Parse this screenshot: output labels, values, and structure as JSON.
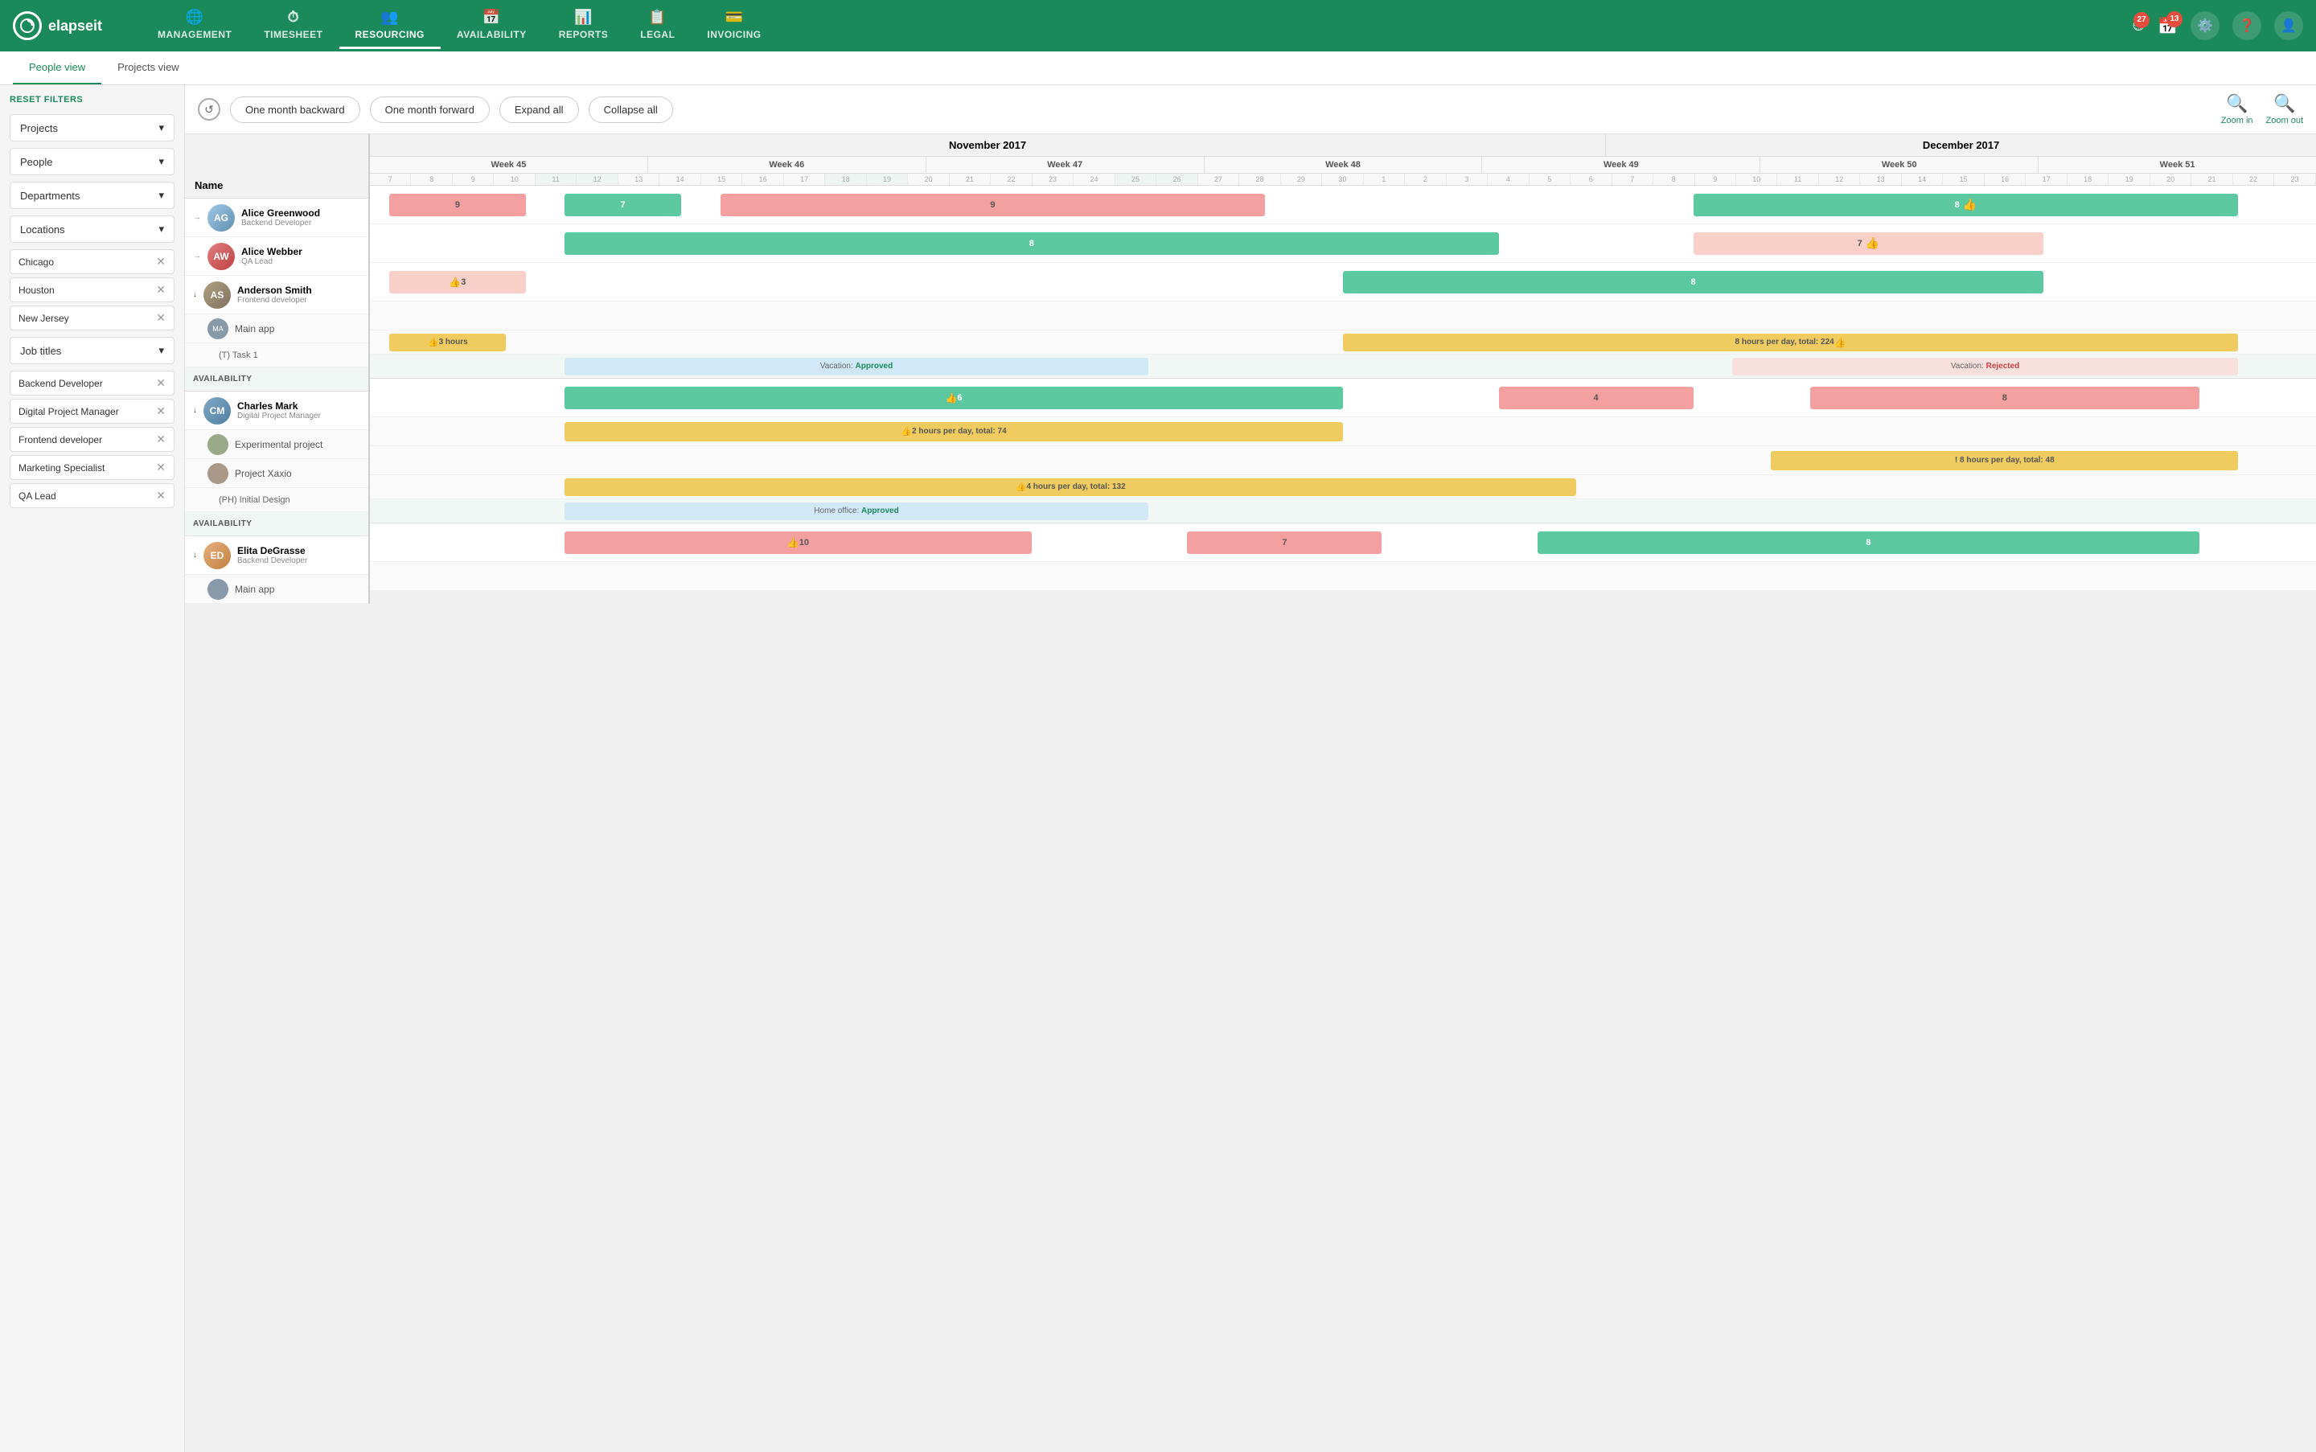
{
  "app": {
    "logo": "elapseit",
    "nav_items": [
      {
        "label": "MANAGEMENT",
        "icon": "🌐",
        "active": false
      },
      {
        "label": "TIMESHEET",
        "icon": "⏱",
        "active": false
      },
      {
        "label": "RESOURCING",
        "icon": "👥",
        "active": true
      },
      {
        "label": "AVAILABILITY",
        "icon": "📅",
        "active": false
      },
      {
        "label": "REPORTS",
        "icon": "📊",
        "active": false
      },
      {
        "label": "LEGAL",
        "icon": "📋",
        "active": false
      },
      {
        "label": "INVOICING",
        "icon": "💳",
        "active": false
      }
    ],
    "badge_timer": "27",
    "badge_cal": "13"
  },
  "sub_nav": [
    {
      "label": "People view",
      "active": true
    },
    {
      "label": "Projects view",
      "active": false
    }
  ],
  "toolbar": {
    "btn_backward": "One month backward",
    "btn_forward": "One month forward",
    "btn_expand": "Expand all",
    "btn_collapse": "Collapse all",
    "zoom_in": "Zoom in",
    "zoom_out": "Zoom out"
  },
  "sidebar": {
    "reset": "RESET FILTERS",
    "filters": [
      {
        "label": "Projects",
        "type": "dropdown"
      },
      {
        "label": "People",
        "type": "dropdown"
      },
      {
        "label": "Departments",
        "type": "dropdown"
      },
      {
        "label": "Locations",
        "type": "dropdown"
      }
    ],
    "location_tags": [
      "Chicago",
      "Houston",
      "New Jersey"
    ],
    "job_title_filter": {
      "label": "Job titles",
      "type": "dropdown"
    },
    "job_tags": [
      "Backend Developer",
      "Digital Project Manager",
      "Frontend developer",
      "Marketing Specialist",
      "QA Lead"
    ]
  },
  "header": {
    "name_col": "Name",
    "months": [
      {
        "label": "November 2017",
        "weeks": [
          "Week 45",
          "Week 46",
          "Week 47",
          "Week 48",
          "Week 49"
        ]
      },
      {
        "label": "December 2017",
        "weeks": [
          "Week 50",
          "Week 51"
        ]
      }
    ],
    "days_nov": "7 8 9 10 11 12 13 14 15 16 17 18 19 20 21 22 23 24 25 26 27 28 29 30",
    "days_dec": "1 2 3 4 5 6 7 8 9 10 11 12 13 14 15 16 17 18 19 20 21 22 23"
  },
  "people": [
    {
      "name": "Alice Greenwood",
      "title": "Backend Developer",
      "expanded": false,
      "bars": [
        {
          "color": "pink",
          "label": "9",
          "left": "2%",
          "width": "8%"
        },
        {
          "color": "green",
          "label": "7",
          "left": "12%",
          "width": "6%"
        },
        {
          "color": "pink",
          "label": "9",
          "left": "20%",
          "width": "28%"
        },
        {
          "color": "green",
          "label": "8",
          "left": "70%",
          "width": "26%"
        }
      ]
    },
    {
      "name": "Alice Webber",
      "title": "QA Lead",
      "expanded": false,
      "bars": [
        {
          "color": "green",
          "label": "8",
          "left": "12%",
          "width": "47%"
        },
        {
          "color": "lpink",
          "label": "7",
          "left": "70%",
          "width": "18%"
        }
      ]
    },
    {
      "name": "Anderson Smith",
      "title": "Frontend developer",
      "expanded": true,
      "bars": [
        {
          "color": "lpink",
          "label": "👍 3",
          "left": "2%",
          "width": "7%"
        },
        {
          "color": "green",
          "label": "8",
          "left": "50%",
          "width": "36%"
        }
      ],
      "projects": [
        {
          "name": "Main app",
          "tasks": [
            {
              "label": "(T) Task 1",
              "bars": [
                {
                  "color": "yellow",
                  "label": "👍 3 hours",
                  "left": "2%",
                  "width": "6%"
                },
                {
                  "color": "yellow",
                  "label": "8 hours per day, total: 224",
                  "left": "50%",
                  "width": "46%"
                }
              ]
            }
          ]
        }
      ],
      "availability": {
        "label": "AVAILABILITY",
        "bars": [
          {
            "type": "vacation-approved",
            "label": "Vacation:  Approved",
            "left": "12%",
            "width": "30%"
          },
          {
            "type": "vacation-rejected",
            "label": "Vacation:  Rejected",
            "left": "70%",
            "width": "26%"
          }
        ]
      }
    },
    {
      "name": "Charles Mark",
      "title": "Digital Project Manager",
      "expanded": true,
      "bars": [
        {
          "color": "green",
          "label": "👍 6",
          "left": "12%",
          "width": "40%"
        },
        {
          "color": "pink",
          "label": "4",
          "left": "60%",
          "width": "10%"
        },
        {
          "color": "pink",
          "label": "8",
          "left": "76%",
          "width": "20%"
        }
      ],
      "projects": [
        {
          "name": "Experimental project",
          "tasks": [
            {
              "label": "",
              "bars": [
                {
                  "color": "yellow",
                  "label": "👍 2 hours per day, total: 74",
                  "left": "12%",
                  "width": "40%"
                }
              ]
            }
          ]
        },
        {
          "name": "Project Xaxio",
          "tasks": [
            {
              "label": "",
              "bars": [
                {
                  "color": "yellow",
                  "label": "! 8 hours per day, total: 48",
                  "left": "72%",
                  "width": "22%"
                }
              ]
            }
          ]
        },
        {
          "name": "(PH) Initial Design",
          "tasks": [
            {
              "label": "",
              "bars": [
                {
                  "color": "yellow",
                  "label": "👍 4 hours per day, total: 132",
                  "left": "12%",
                  "width": "52%"
                }
              ]
            }
          ]
        }
      ],
      "availability": {
        "label": "AVAILABILITY",
        "bars": [
          {
            "type": "home-office",
            "label": "Home office:  Approved",
            "left": "12%",
            "width": "30%"
          }
        ]
      }
    },
    {
      "name": "Elita DeGrasse",
      "title": "Backend Developer",
      "expanded": true,
      "bars": [
        {
          "color": "pink",
          "label": "👍 10",
          "left": "12%",
          "width": "24%"
        },
        {
          "color": "pink",
          "label": "7",
          "left": "44%",
          "width": "10%"
        },
        {
          "color": "green",
          "label": "8",
          "left": "62%",
          "width": "34%"
        }
      ],
      "projects": [
        {
          "name": "Main app",
          "tasks": []
        }
      ]
    }
  ]
}
